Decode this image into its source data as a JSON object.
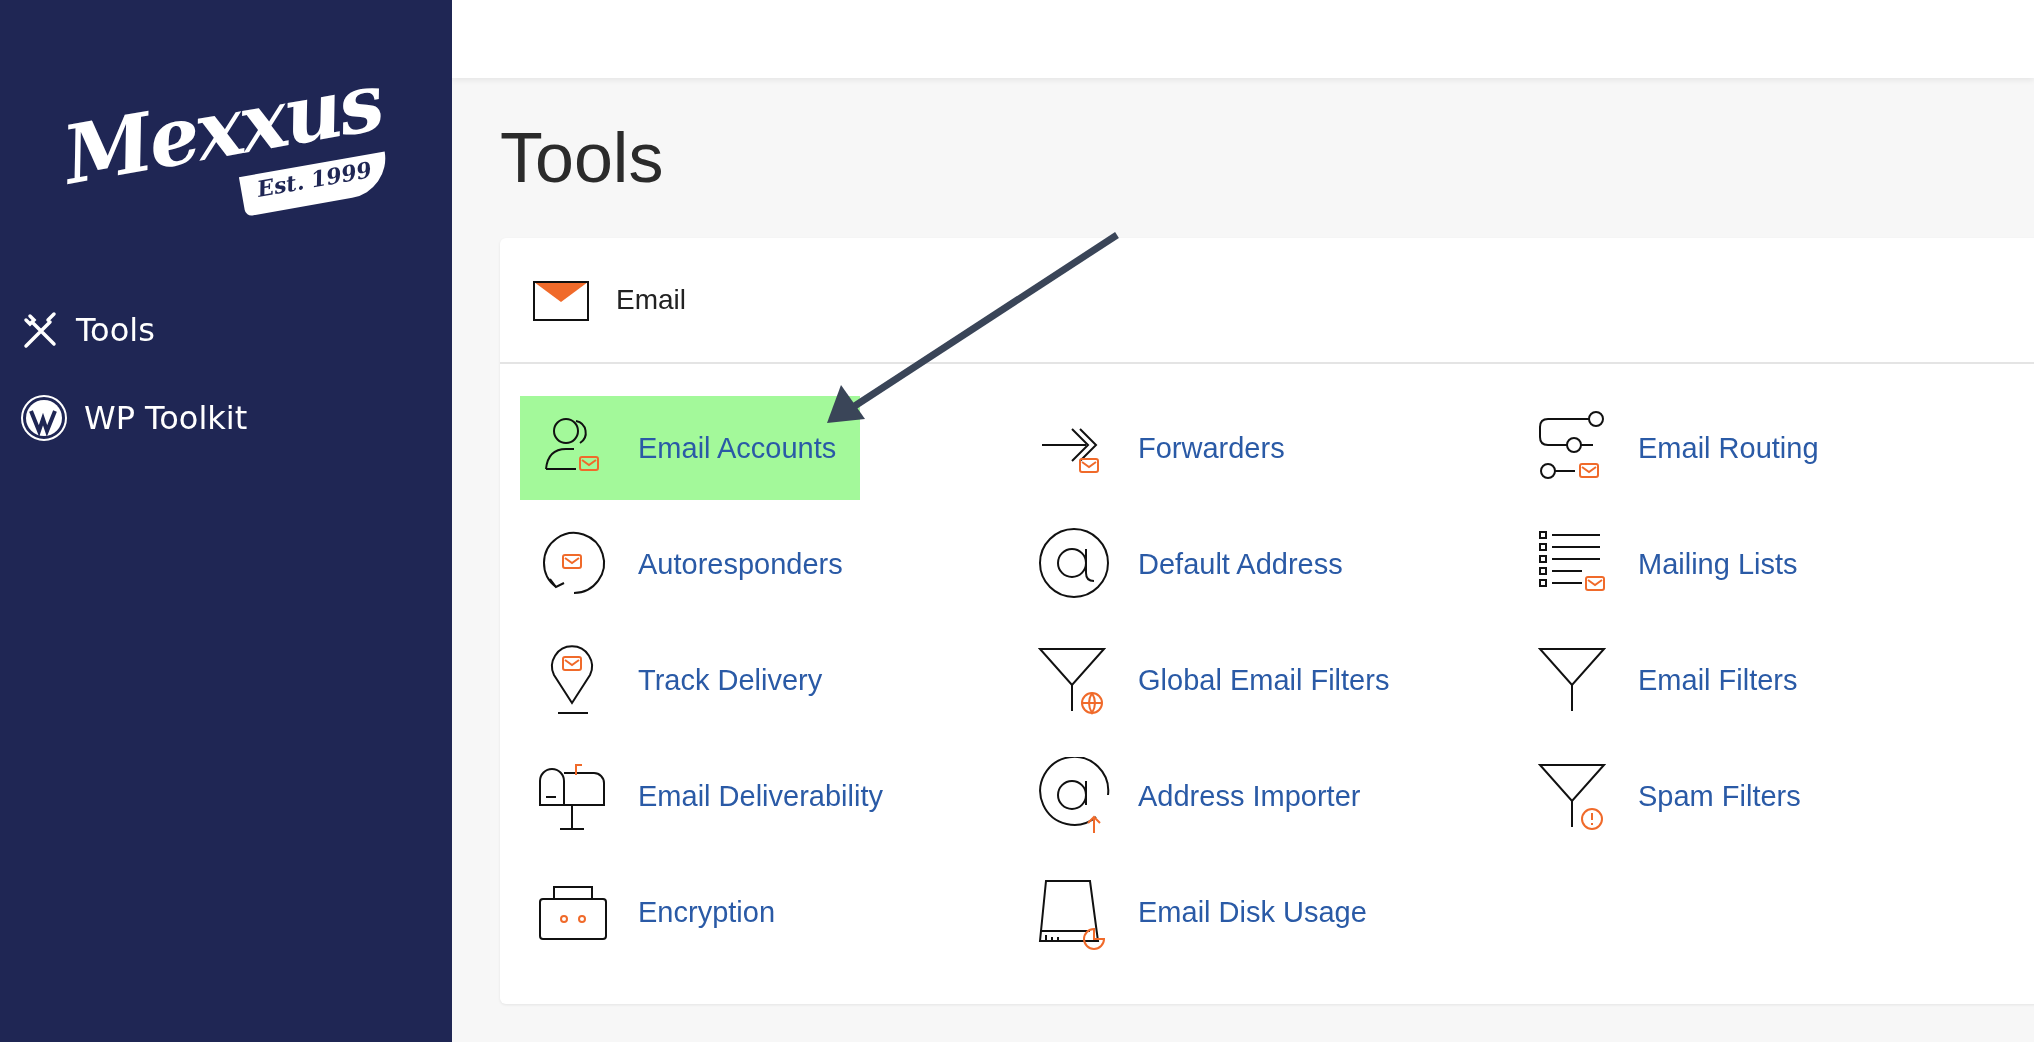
{
  "sidebar": {
    "logo": {
      "name": "Mexxus",
      "tagline": "Est. 1999"
    },
    "items": [
      {
        "label": "Tools",
        "selected": false
      },
      {
        "label": "WP Toolkit",
        "selected": false
      }
    ]
  },
  "page_title": "Tools",
  "section": {
    "title": "Email",
    "items": [
      {
        "label": "Email Accounts",
        "highlighted": true
      },
      {
        "label": "Forwarders",
        "highlighted": false
      },
      {
        "label": "Email Routing",
        "highlighted": false
      },
      {
        "label": "Autoresponders",
        "highlighted": false
      },
      {
        "label": "Default Address",
        "highlighted": false
      },
      {
        "label": "Mailing Lists",
        "highlighted": false
      },
      {
        "label": "Track Delivery",
        "highlighted": false
      },
      {
        "label": "Global Email Filters",
        "highlighted": false
      },
      {
        "label": "Email Filters",
        "highlighted": false
      },
      {
        "label": "Email Deliverability",
        "highlighted": false
      },
      {
        "label": "Address Importer",
        "highlighted": false
      },
      {
        "label": "Spam Filters",
        "highlighted": false
      },
      {
        "label": "Encryption",
        "highlighted": false
      },
      {
        "label": "Email Disk Usage",
        "highlighted": false
      }
    ]
  }
}
